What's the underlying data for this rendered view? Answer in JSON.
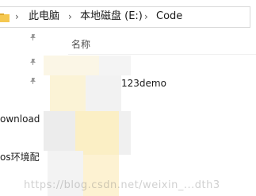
{
  "breadcrumb": {
    "items": [
      {
        "label": "此电脑"
      },
      {
        "label": "本地磁盘 (E:)"
      },
      {
        "label": "Code"
      }
    ],
    "separator": "›"
  },
  "nav": {
    "items": [
      {
        "label": "ownload"
      },
      {
        "label": "os环境配"
      }
    ]
  },
  "content": {
    "column_header": "名称",
    "files": [
      {
        "name": "python123demo",
        "icon": "folder-icon"
      }
    ]
  },
  "watermark": "https://blog.csdn.net/weixin_...dth3",
  "colors": {
    "folder": "#f5c851",
    "folder_dark": "#e0aa2e",
    "pin": "#9a9a9a"
  }
}
